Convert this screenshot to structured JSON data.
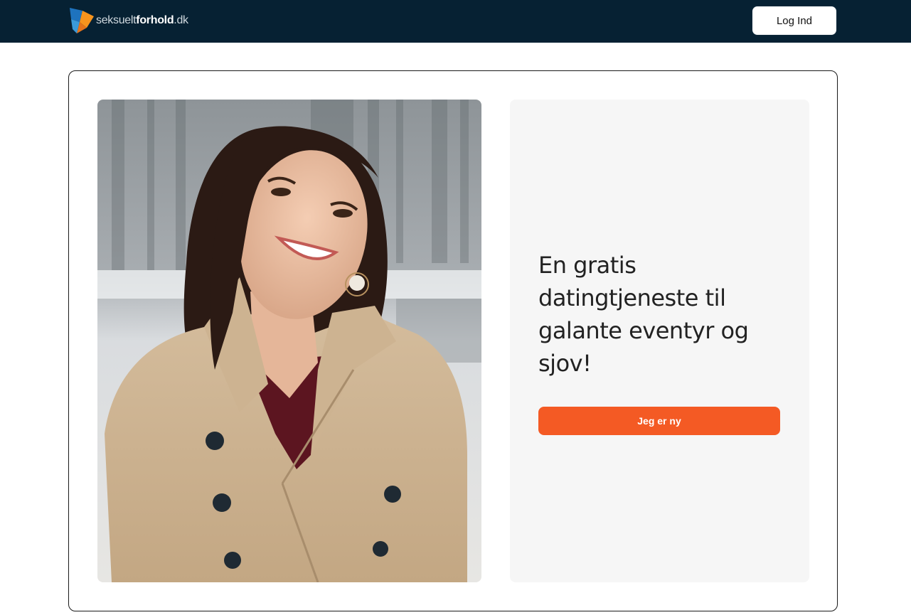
{
  "header": {
    "logo": {
      "text_light": "seksuelt",
      "text_bold": "forhold",
      "text_suffix": ".dk"
    },
    "login_label": "Log Ind"
  },
  "hero": {
    "photo_alt": "Smiling woman in beige trench coat",
    "headline": "En gratis datingtjeneste til galante eventyr og sjov!",
    "cta_label": "Jeg er ny"
  },
  "colors": {
    "header_bg": "#062133",
    "accent": "#f45a24",
    "panel_bg": "#f6f6f6",
    "logo_blue": "#1e73be",
    "logo_orange": "#f7941d"
  }
}
